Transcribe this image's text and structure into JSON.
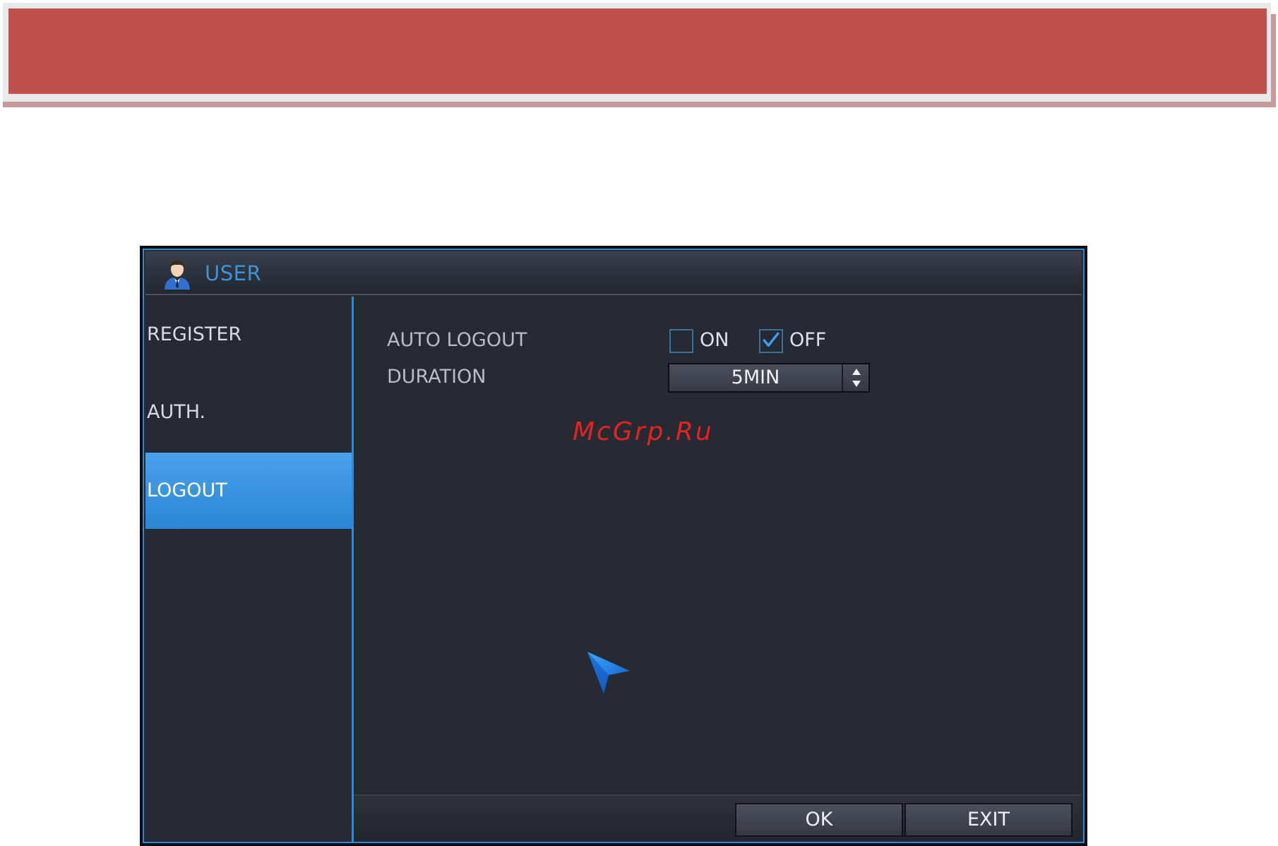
{
  "window": {
    "title": "USER"
  },
  "sidebar": {
    "items": [
      {
        "label": "REGISTER",
        "active": false
      },
      {
        "label": "AUTH.",
        "active": false
      },
      {
        "label": "LOGOUT",
        "active": true
      }
    ]
  },
  "settings": {
    "auto_logout": {
      "label": "AUTO LOGOUT",
      "options": [
        {
          "label": "ON",
          "checked": false
        },
        {
          "label": "OFF",
          "checked": true
        }
      ]
    },
    "duration": {
      "label": "DURATION",
      "value": "5MIN"
    }
  },
  "watermark": "McGrp.Ru",
  "footer": {
    "ok_label": "OK",
    "exit_label": "EXIT"
  },
  "colors": {
    "banner": "#c0504d",
    "accent": "#2d8ad6",
    "active_item": "#3b95e0",
    "background": "#252a33",
    "watermark": "#e52321"
  },
  "icons": {
    "title": "user-icon",
    "checkbox_checked": "checkmark-icon",
    "spinner": "up-down-arrows-icon",
    "pointer": "mouse-cursor-icon"
  }
}
